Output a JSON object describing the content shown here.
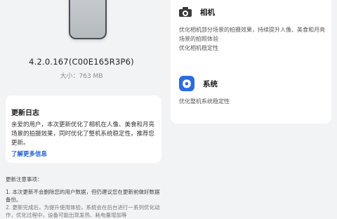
{
  "left": {
    "version": "4.2.0.167(C00E165R3P6)",
    "size": "大小：763 MB",
    "changelog": {
      "title": "更新日志",
      "body": "亲爱的用户，本次更新优化了相机在人像、美食和月亮场景的拍摄效果，同时优化了整机系统稳定性，推荐您更新。",
      "link": "了解更多信息"
    },
    "notes": {
      "title": "更新注意事项：",
      "item1": "1. 本次更新不会删除您的用户数据，但仍建议您在更新前做好数据备份。",
      "item2": "2. 更新完成后，为提升使用体验，系统会在后台进行一系列优化动作，优化过程中，设备可能出现发热、耗电量增加等"
    }
  },
  "right": {
    "camera": {
      "name": "相机",
      "icon": "camera-icon",
      "desc1": "优化相机部分场景的拍摄效果，持续提升人像、美食和月亮场景的拍照体验",
      "desc2": "优化相机稳定性"
    },
    "system": {
      "name": "系统",
      "icon": "settings-gear-icon",
      "desc": "优化整机系统稳定性"
    }
  },
  "colors": {
    "background": "#f1f3f5",
    "link": "#1f5fd6",
    "system_icon": "#2d6be0"
  }
}
